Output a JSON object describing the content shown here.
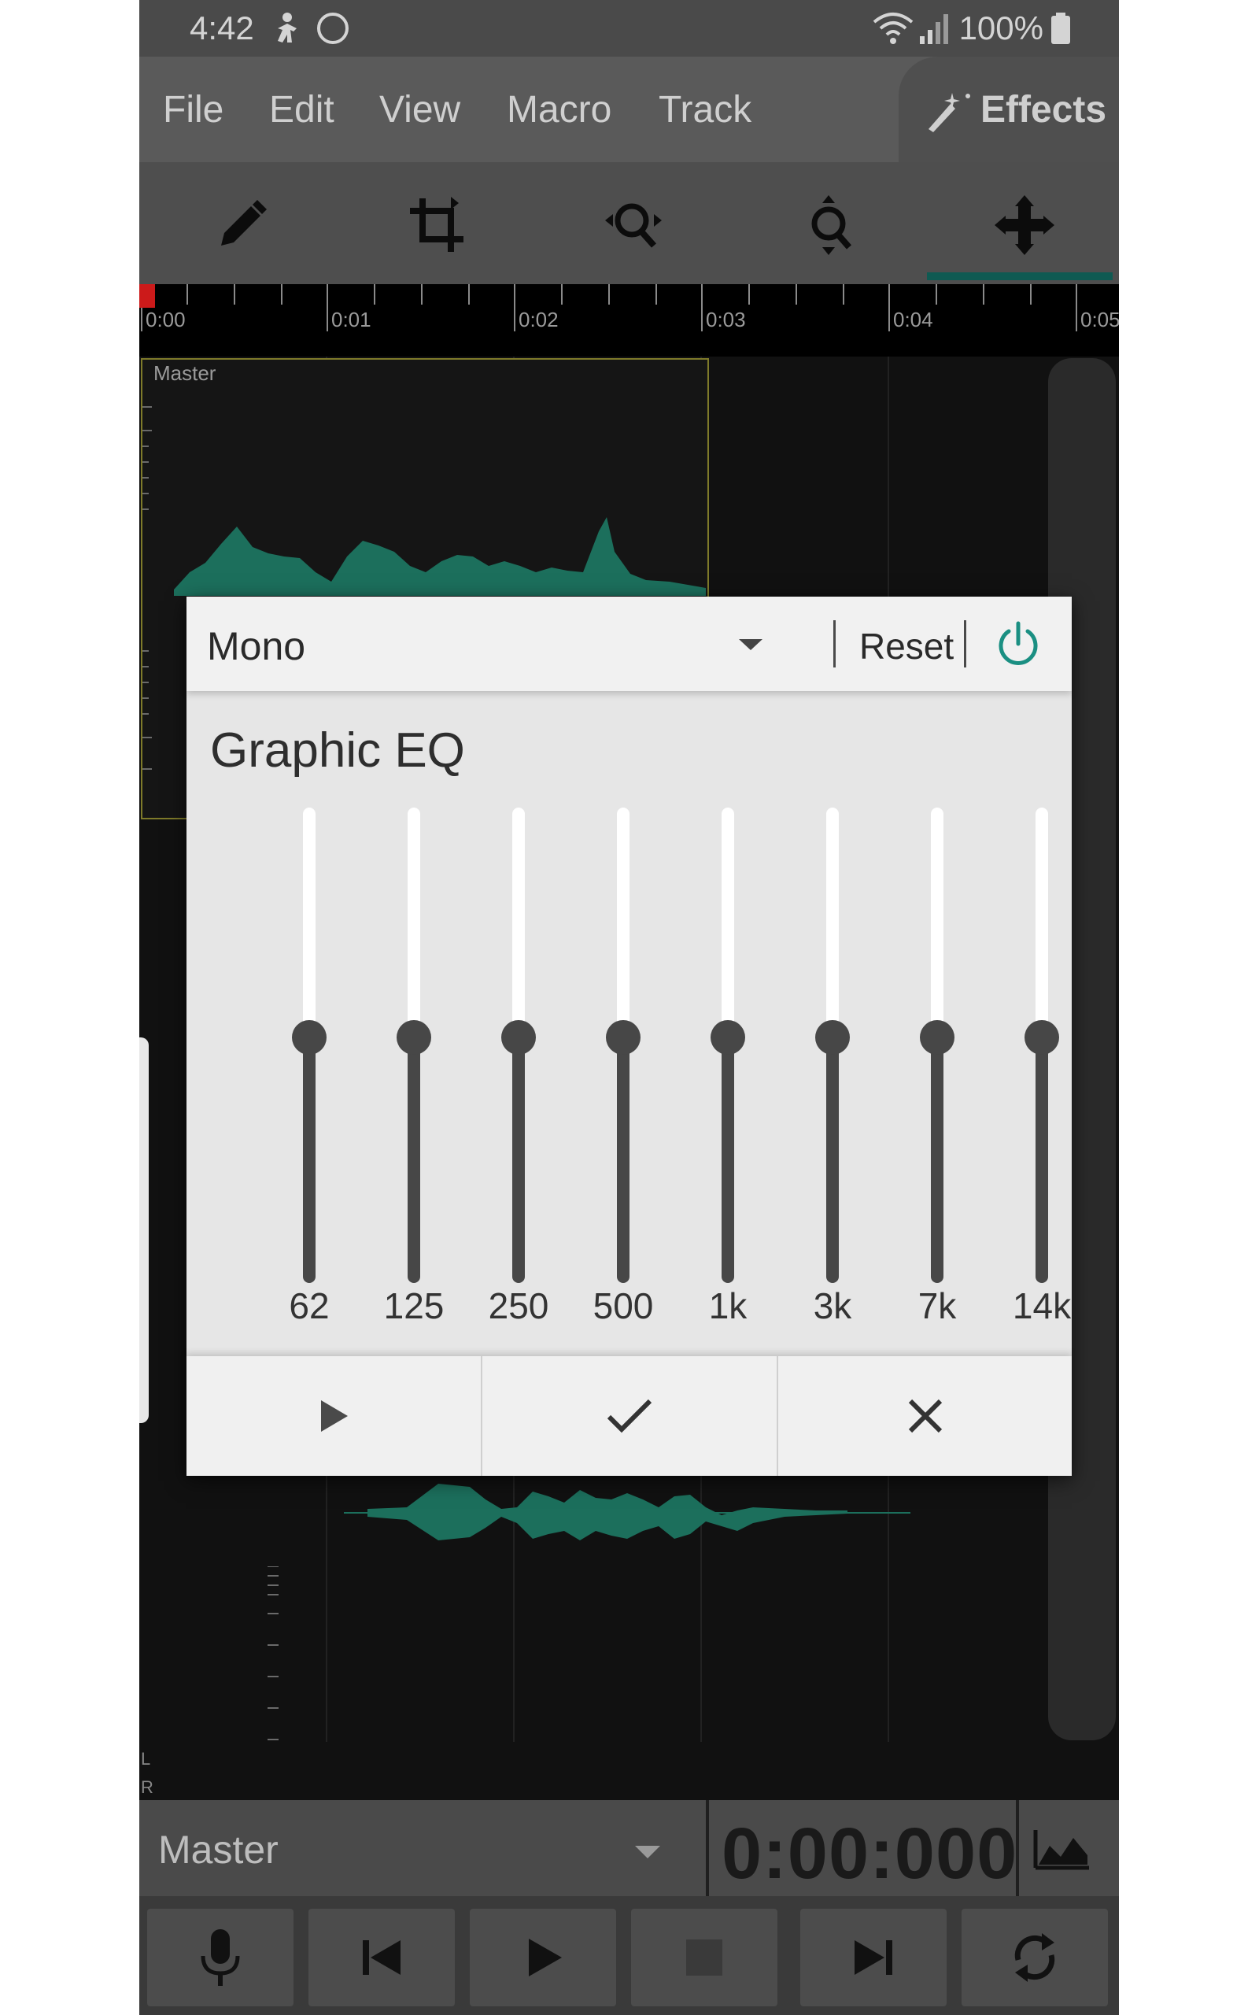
{
  "status_bar": {
    "time": "4:42",
    "battery": "100%",
    "icons": [
      "accessibility-icon",
      "sync-circle-icon",
      "wifi-icon",
      "signal-icon",
      "battery-icon"
    ]
  },
  "menu": {
    "items": [
      "File",
      "Edit",
      "View",
      "Macro",
      "Track"
    ],
    "effects_label": "Effects"
  },
  "toolbar": {
    "tools": [
      "pencil-icon",
      "crop-icon",
      "zoom-horizontal-icon",
      "zoom-vertical-icon",
      "move-icon"
    ],
    "active": "move-icon"
  },
  "timeline": {
    "marks": [
      "0:00",
      "0:01",
      "0:02",
      "0:03",
      "0:04",
      "0:05"
    ],
    "track_label": "Master",
    "channel_labels": [
      "L",
      "R"
    ]
  },
  "dialog": {
    "preset": "Mono",
    "reset_label": "Reset",
    "title": "Graphic EQ",
    "bands": [
      {
        "freq": "62",
        "level": 0.5
      },
      {
        "freq": "125",
        "level": 0.5
      },
      {
        "freq": "250",
        "level": 0.5
      },
      {
        "freq": "500",
        "level": 0.5
      },
      {
        "freq": "1k",
        "level": 0.5
      },
      {
        "freq": "3k",
        "level": 0.5
      },
      {
        "freq": "7k",
        "level": 0.5
      },
      {
        "freq": "14k",
        "level": 0.5
      }
    ],
    "footer": [
      "play-icon",
      "check-icon",
      "close-icon"
    ],
    "accent_color": "#1a8f82"
  },
  "bottom": {
    "track": "Master",
    "time": "0:00:000"
  },
  "transport": [
    "microphone-icon",
    "skip-previous-icon",
    "play-icon",
    "stop-icon",
    "skip-next-icon",
    "loop-icon"
  ],
  "colors": {
    "waveform": "#1c6f5c",
    "accent": "#1a8f82"
  }
}
